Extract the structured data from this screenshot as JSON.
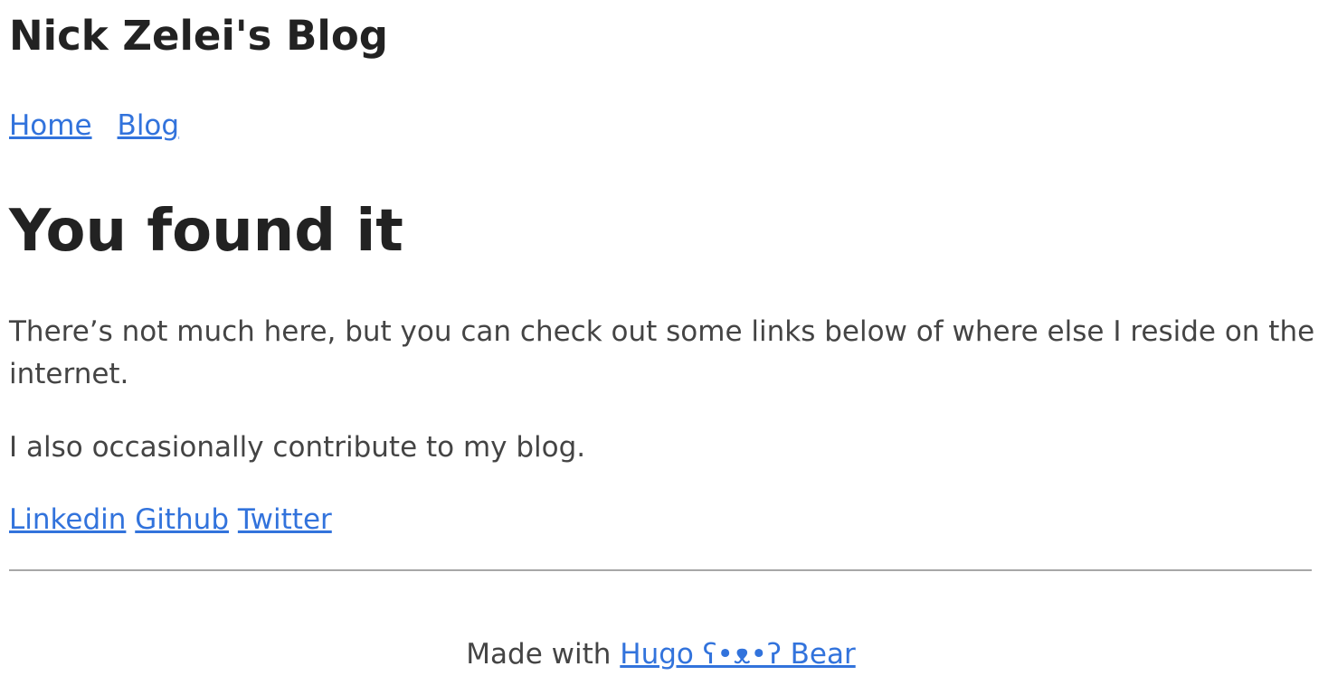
{
  "header": {
    "site_title": "Nick Zelei's Blog",
    "nav": {
      "home": "Home",
      "blog": "Blog"
    }
  },
  "main": {
    "title": "You found it",
    "paragraph_1": "There’s not much here, but you can check out some links below of where else I reside on the internet.",
    "paragraph_2": "I also occasionally contribute to my blog.",
    "links": {
      "linkedin": "Linkedin",
      "github": "Github",
      "twitter": "Twitter"
    }
  },
  "footer": {
    "prefix": "Made with ",
    "link_text": "Hugo ʕ•ᴥ•ʔ Bear"
  },
  "colors": {
    "link": "#3273dc",
    "heading": "#222222",
    "text": "#444444",
    "divider": "#a7a7a7"
  }
}
